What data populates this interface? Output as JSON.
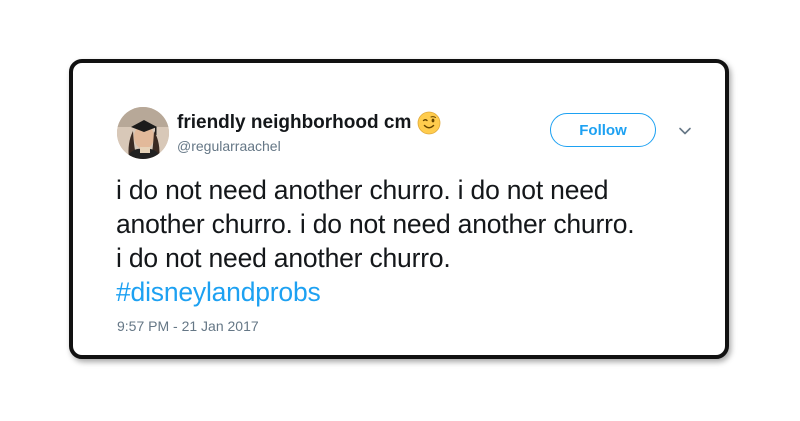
{
  "tweet": {
    "display_name": "friendly neighborhood cm",
    "emoji_icon": "winking-face-emoji",
    "handle": "@regularraachel",
    "follow_label": "Follow",
    "text_lines": [
      "i do not need another churro. i do not need",
      "another churro. i do not need another churro.",
      "i do not need another churro."
    ],
    "hashtag": "#disneylandprobs",
    "timestamp": "9:57 PM - 21 Jan 2017"
  },
  "colors": {
    "accent": "#1da1f2",
    "text": "#14171a",
    "muted": "#657786",
    "border": "#111111"
  },
  "icons": {
    "menu": "chevron-down-icon",
    "avatar": "profile-photo"
  }
}
